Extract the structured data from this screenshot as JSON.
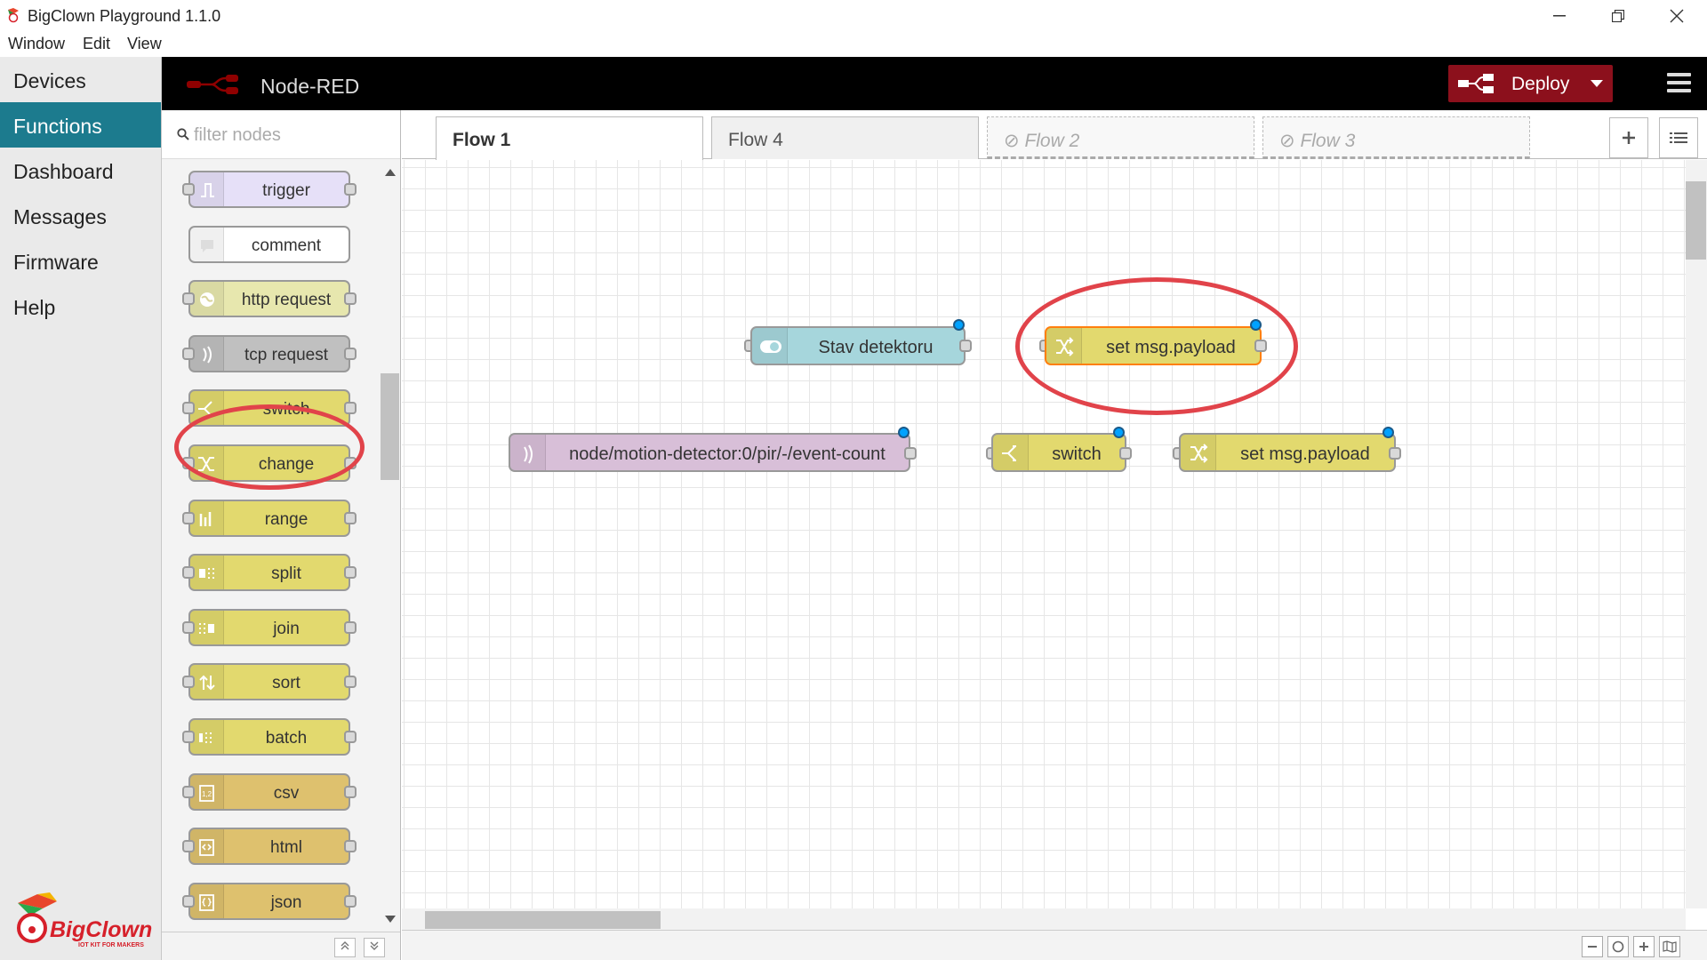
{
  "window": {
    "title": "BigClown Playground 1.1.0",
    "menu": [
      "Window",
      "Edit",
      "View"
    ]
  },
  "app_nav": {
    "items": [
      {
        "label": "Devices",
        "active": false
      },
      {
        "label": "Functions",
        "active": true
      },
      {
        "label": "Dashboard",
        "active": false
      },
      {
        "label": "Messages",
        "active": false
      },
      {
        "label": "Firmware",
        "active": false
      },
      {
        "label": "Help",
        "active": false
      }
    ],
    "logo_text": "BigClown",
    "logo_tagline": "IOT KIT FOR MAKERS"
  },
  "header": {
    "title": "Node-RED",
    "deploy_label": "Deploy"
  },
  "palette": {
    "filter_placeholder": "filter nodes",
    "nodes": [
      {
        "label": "trigger",
        "color": "#e6e0f8",
        "icon": "trigger-icon"
      },
      {
        "label": "comment",
        "color": "#ffffff",
        "icon": "comment-icon"
      },
      {
        "label": "http request",
        "color": "#e7e7ae",
        "icon": "globe-icon"
      },
      {
        "label": "tcp request",
        "color": "#c0c0c0",
        "icon": "bridge-icon"
      },
      {
        "label": "switch",
        "color": "#e2d96e",
        "icon": "switch-icon"
      },
      {
        "label": "change",
        "color": "#e2d96e",
        "icon": "shuffle-icon"
      },
      {
        "label": "range",
        "color": "#e2d96e",
        "icon": "range-icon"
      },
      {
        "label": "split",
        "color": "#e2d96e",
        "icon": "split-icon"
      },
      {
        "label": "join",
        "color": "#e2d96e",
        "icon": "join-icon"
      },
      {
        "label": "sort",
        "color": "#e2d96e",
        "icon": "sort-icon"
      },
      {
        "label": "batch",
        "color": "#e2d96e",
        "icon": "batch-icon"
      },
      {
        "label": "csv",
        "color": "#dec16e",
        "icon": "csv-icon"
      },
      {
        "label": "html",
        "color": "#dec16e",
        "icon": "html-icon"
      },
      {
        "label": "json",
        "color": "#dec16e",
        "icon": "json-icon"
      }
    ]
  },
  "tabs": [
    {
      "label": "Flow 1",
      "state": "active"
    },
    {
      "label": "Flow 4",
      "state": "normal"
    },
    {
      "label": "Flow 2",
      "state": "disabled"
    },
    {
      "label": "Flow 3",
      "state": "disabled"
    }
  ],
  "flow_nodes": [
    {
      "label": "Stav detektoru",
      "color": "#a6d6dc",
      "icon": "toggle-icon"
    },
    {
      "label": "set msg.payload",
      "color": "#e2d96e",
      "icon": "shuffle-icon",
      "selected": true
    },
    {
      "label": "node/motion-detector:0/pir/-/event-count",
      "color": "#d8bfd8",
      "icon": "bridge-icon"
    },
    {
      "label": "switch",
      "color": "#e2d96e",
      "icon": "switch-icon"
    },
    {
      "label": "set msg.payload",
      "color": "#e2d96e",
      "icon": "shuffle-icon"
    }
  ],
  "colors": {
    "accent": "#1c7b8e",
    "deploy": "#8c101c",
    "annotation": "#e1434a",
    "changed_indicator": "#00a2ff"
  }
}
